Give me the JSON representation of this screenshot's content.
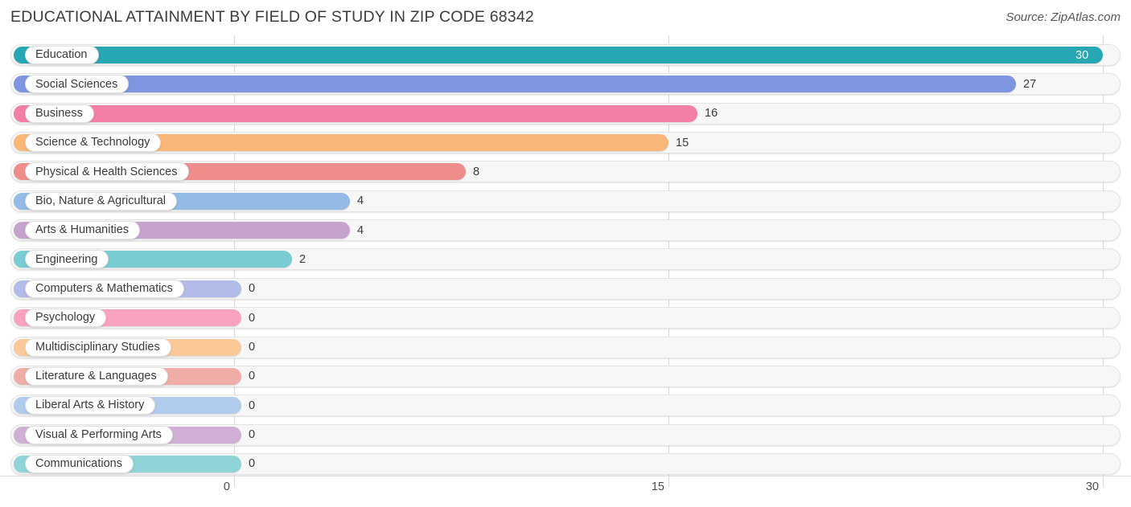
{
  "header": {
    "title": "EDUCATIONAL ATTAINMENT BY FIELD OF STUDY IN ZIP CODE 68342",
    "source": "Source: ZipAtlas.com"
  },
  "axis": {
    "ticks": [
      {
        "label": "0",
        "value": 0
      },
      {
        "label": "15",
        "value": 15
      },
      {
        "label": "30",
        "value": 30
      }
    ]
  },
  "chart_data": {
    "type": "bar",
    "orientation": "horizontal",
    "title": "EDUCATIONAL ATTAINMENT BY FIELD OF STUDY IN ZIP CODE 68342",
    "subtitle": "",
    "xlabel": "",
    "ylabel": "",
    "xlim": [
      0,
      30
    ],
    "grid": true,
    "legend": false,
    "source": "Source: ZipAtlas.com",
    "categories": [
      "Education",
      "Social Sciences",
      "Business",
      "Science & Technology",
      "Physical & Health Sciences",
      "Bio, Nature & Agricultural",
      "Arts & Humanities",
      "Engineering",
      "Computers & Mathematics",
      "Psychology",
      "Multidisciplinary Studies",
      "Literature & Languages",
      "Liberal Arts & History",
      "Visual & Performing Arts",
      "Communications"
    ],
    "values": [
      30,
      27,
      16,
      15,
      8,
      4,
      4,
      2,
      0,
      0,
      0,
      0,
      0,
      0,
      0
    ],
    "value_labels": [
      "30",
      "27",
      "16",
      "15",
      "8",
      "4",
      "4",
      "2",
      "0",
      "0",
      "0",
      "0",
      "0",
      "0",
      "0"
    ],
    "colors": [
      "#27a6b3",
      "#7e96e0",
      "#f47fa6",
      "#fbb778",
      "#ef8d8a",
      "#93bbe5",
      "#c6a3cd",
      "#79ccd2",
      "#b3bce8",
      "#f9a2c0",
      "#fbc998",
      "#f0ada7",
      "#b0cbeb",
      "#d0afd4",
      "#8fd4d6"
    ]
  }
}
